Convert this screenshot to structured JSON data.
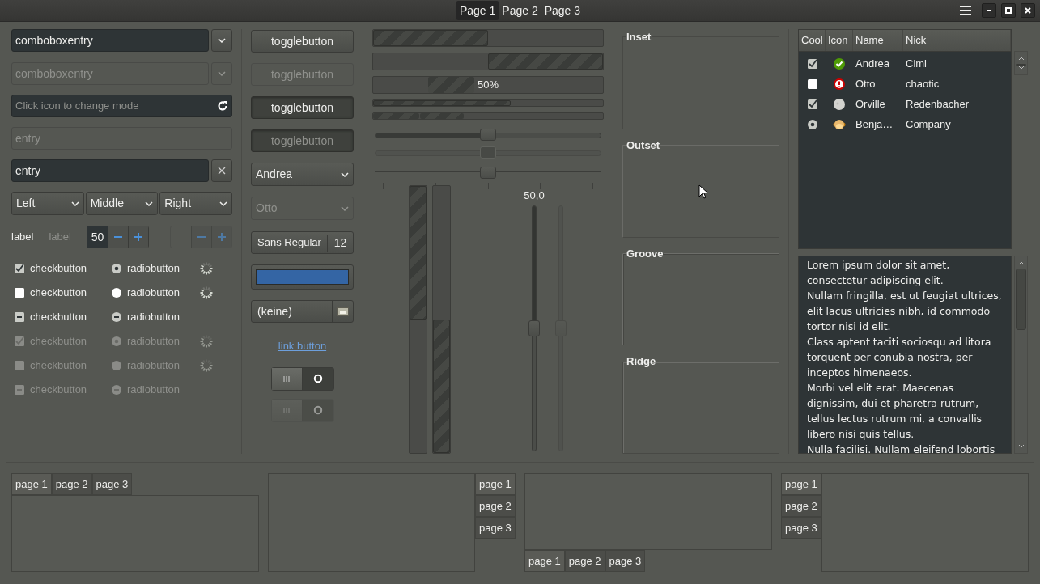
{
  "header": {
    "tabs": [
      {
        "label": "Page 1",
        "selected": true
      },
      {
        "label": "Page 2",
        "selected": false
      },
      {
        "label": "Page 3",
        "selected": false
      }
    ]
  },
  "entries_column": {
    "combo_entries": [
      {
        "value": "comboboxentry",
        "disabled": false
      },
      {
        "value": "comboboxentry",
        "disabled": true
      }
    ],
    "icon_entry": {
      "placeholder": "Click icon to change mode"
    },
    "entries": [
      {
        "value": "entry",
        "disabled": true,
        "clear": false
      },
      {
        "value": "entry",
        "disabled": false,
        "clear": true
      }
    ],
    "combos": [
      "Left",
      "Middle",
      "Right"
    ],
    "labels": [
      {
        "text": "label",
        "disabled": false
      },
      {
        "text": "label",
        "disabled": true
      }
    ],
    "spins": [
      {
        "value": "50",
        "disabled": false
      },
      {
        "disabled": true
      }
    ],
    "rows": [
      {
        "check_label": "checkbutton",
        "radio_label": "radiobutton",
        "checked": true,
        "inconsistent": false,
        "disabled": false,
        "spinner": true
      },
      {
        "check_label": "checkbutton",
        "radio_label": "radiobutton",
        "checked": false,
        "inconsistent": false,
        "disabled": false,
        "spinner": true
      },
      {
        "check_label": "checkbutton",
        "radio_label": "radiobutton",
        "inconsistent": true,
        "disabled": false,
        "spinner": false
      },
      {
        "check_label": "checkbutton",
        "radio_label": "radiobutton",
        "checked": true,
        "inconsistent": false,
        "disabled": true,
        "spinner": true
      },
      {
        "check_label": "checkbutton",
        "radio_label": "radiobutton",
        "checked": false,
        "inconsistent": false,
        "disabled": true,
        "spinner": true
      },
      {
        "check_label": "checkbutton",
        "radio_label": "radiobutton",
        "inconsistent": true,
        "disabled": true,
        "spinner": false
      }
    ]
  },
  "buttons_column": {
    "toggles": [
      {
        "label": "togglebutton",
        "active": false,
        "disabled": false
      },
      {
        "label": "togglebutton",
        "active": false,
        "disabled": true
      },
      {
        "label": "togglebutton",
        "active": true,
        "disabled": false
      },
      {
        "label": "togglebutton",
        "active": true,
        "disabled": true
      }
    ],
    "combos": [
      {
        "value": "Andrea",
        "disabled": false
      },
      {
        "value": "Otto",
        "disabled": true
      }
    ],
    "font_button": {
      "family": "Sans Regular",
      "size": "12"
    },
    "color_button": {
      "color": "#3465a4"
    },
    "file_button": {
      "value": "(keine)"
    },
    "link": "link button",
    "switches": [
      {
        "on": false,
        "disabled": false
      },
      {
        "on": false,
        "disabled": true
      }
    ]
  },
  "ranges_column": {
    "progress": [
      {
        "kind": "fill",
        "level": 0.5,
        "inverted": false,
        "small": false
      },
      {
        "kind": "fill",
        "level": 0.5,
        "inverted": true,
        "small": false
      },
      {
        "kind": "pulse",
        "small": false,
        "text": "50%"
      },
      {
        "kind": "fill",
        "level": 0.6,
        "inverted": false,
        "small": true
      },
      {
        "kind": "pulse",
        "small": true
      }
    ],
    "hscales": [
      {
        "level": 0.5,
        "filled": true,
        "disabled": false,
        "marks": false
      },
      {
        "level": 0.5,
        "disabled": true,
        "marks": false
      },
      {
        "level": 0.5,
        "disabled": false,
        "marks": true
      }
    ],
    "vprogress": [
      {
        "level": 0.5,
        "inverted": false
      },
      {
        "level": 0.5,
        "inverted": true
      }
    ],
    "vscales": [
      {
        "level": 0.5,
        "value": "50,0",
        "filled": true,
        "disabled": false
      },
      {
        "level": 0.5,
        "disabled": true
      }
    ]
  },
  "frames": [
    {
      "label": "Inset",
      "kind": "inset"
    },
    {
      "label": "Outset",
      "kind": "outset"
    },
    {
      "label": "Groove",
      "kind": "groove"
    },
    {
      "label": "Ridge",
      "kind": "ridge"
    }
  ],
  "tree": {
    "columns": [
      "Cool",
      "Icon",
      "Name",
      "Nick"
    ],
    "rows": [
      {
        "radio": false,
        "checked": true,
        "name": "Andrea",
        "nick": "Cimi"
      },
      {
        "radio": false,
        "checked": false,
        "name": "Otto",
        "nick": "chaotic"
      },
      {
        "radio": false,
        "checked": true,
        "name": "Orville",
        "nick": "Redenbacher"
      },
      {
        "radio": true,
        "checked": true,
        "name": "Benja…",
        "nick": "Company"
      }
    ]
  },
  "text_view": {
    "paragraphs": [
      "Lorem ipsum dolor sit amet, consectetur adipiscing elit.",
      "Nullam fringilla, est ut feugiat ultrices, elit lacus ultricies nibh, id commodo tortor nisi id elit.",
      "Class aptent taciti sociosqu ad litora torquent per conubia nostra, per inceptos himenaeos.",
      "Morbi vel elit erat. Maecenas dignissim, dui et pharetra rutrum, tellus lectus rutrum mi, a convallis libero nisi quis tellus.",
      "Nulla facilisi. Nullam eleifend lobortis"
    ]
  },
  "notebooks": [
    {
      "kind": "top",
      "tabs": [
        {
          "label": "page 1",
          "selected": true
        },
        {
          "label": "page 2",
          "selected": false
        },
        {
          "label": "page 3",
          "selected": false
        }
      ]
    },
    {
      "kind": "right",
      "tabs": [
        {
          "label": "page 1",
          "selected": true
        },
        {
          "label": "page 2",
          "selected": false
        },
        {
          "label": "page 3",
          "selected": false
        }
      ]
    },
    {
      "kind": "bottom",
      "tabs": [
        {
          "label": "page 1",
          "selected": true
        },
        {
          "label": "page 2",
          "selected": false
        },
        {
          "label": "page 3",
          "selected": false
        }
      ]
    },
    {
      "kind": "left",
      "tabs": [
        {
          "label": "page 1",
          "selected": true
        },
        {
          "label": "page 2",
          "selected": false
        },
        {
          "label": "page 3",
          "selected": false
        }
      ]
    }
  ]
}
